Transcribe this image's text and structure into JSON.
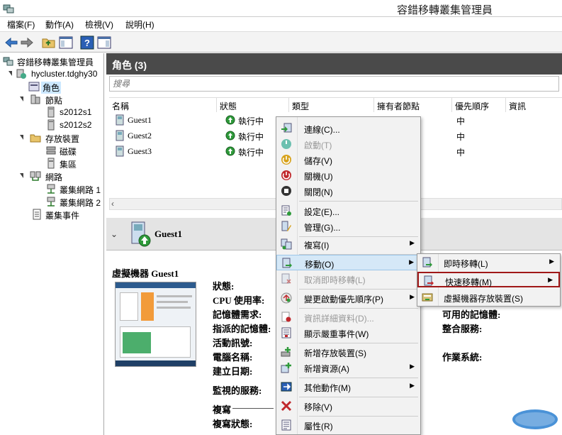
{
  "window": {
    "title": "容錯移轉叢集管理員"
  },
  "menubar": [
    "檔案(F)",
    "動作(A)",
    "檢視(V)",
    "說明(H)"
  ],
  "tree": {
    "root": "容錯移轉叢集管理員",
    "cluster": "hycluster.tdghy30",
    "roles": "角色",
    "nodes": "節點",
    "node1": "s2012s1",
    "node2": "s2012s2",
    "storage": "存放裝置",
    "disks": "磁碟",
    "pools": "集區",
    "networks": "網路",
    "net1": "叢集網路 1",
    "net2": "叢集網路 2",
    "events": "叢集事件"
  },
  "main": {
    "header": "角色 (3)",
    "search_placeholder": "搜尋",
    "columns": [
      "名稱",
      "狀態",
      "類型",
      "擁有者節點",
      "優先順序",
      "資訊"
    ],
    "rows": [
      {
        "name": "Guest1",
        "status": "執行中",
        "priority": "中"
      },
      {
        "name": "Guest2",
        "status": "執行中",
        "priority": "中"
      },
      {
        "name": "Guest3",
        "status": "執行中",
        "priority": "中"
      }
    ]
  },
  "detail": {
    "header_name": "Guest1",
    "section_title": "虛擬機器 Guest1",
    "labels": {
      "status": "狀態:",
      "cpu": "CPU 使用率:",
      "mem_demand": "記憶體需求:",
      "assigned_mem": "指派的記憶體:",
      "heartbeat": "活動訊號:",
      "computer_name": "電腦名稱:",
      "created": "建立日期:",
      "monitored": "監視的服務:",
      "replication": "複寫",
      "replication_status": "複寫狀態:",
      "available_mem": "可用的記憶體:",
      "integration": "整合服務:",
      "os": "作業系統:"
    }
  },
  "context_menu": {
    "items": [
      {
        "label": "連線(C)...",
        "icon": "connect-icon"
      },
      {
        "label": "啟動(T)",
        "icon": "start-icon",
        "disabled": true
      },
      {
        "label": "儲存(V)",
        "icon": "save-icon"
      },
      {
        "label": "關機(U)",
        "icon": "shutdown-icon"
      },
      {
        "label": "關閉(N)",
        "icon": "turnoff-icon"
      },
      {
        "label": "設定(E)...",
        "icon": "settings-icon"
      },
      {
        "label": "管理(G)...",
        "icon": "manage-icon"
      },
      {
        "label": "複寫(I)",
        "icon": "replicate-icon"
      },
      {
        "label": "移動(O)",
        "icon": "move-icon"
      },
      {
        "label": "取消即時移轉(L)",
        "icon": "cancel-migration-icon",
        "disabled": true
      },
      {
        "label": "變更啟動優先順序(P)",
        "icon": "priority-icon"
      },
      {
        "label": "資訊詳細資料(D)...",
        "icon": "info-icon",
        "disabled": true
      },
      {
        "label": "顯示嚴重事件(W)",
        "icon": "events-icon"
      },
      {
        "label": "新增存放裝置(S)",
        "icon": "add-storage-icon"
      },
      {
        "label": "新增資源(A)",
        "icon": "add-resource-icon"
      },
      {
        "label": "其他動作(M)",
        "icon": "more-actions-icon"
      },
      {
        "label": "移除(V)",
        "icon": "remove-icon"
      },
      {
        "label": "屬性(R)",
        "icon": "properties-icon"
      }
    ]
  },
  "submenu": {
    "items": [
      {
        "label": "即時移轉(L)"
      },
      {
        "label": "快速移轉(M)"
      },
      {
        "label": "虛擬機器存放裝置(S)"
      }
    ]
  },
  "colors": {
    "header_bg": "#4a4a4a",
    "highlight_border": "#a01818",
    "selection": "#d5e8f7"
  }
}
